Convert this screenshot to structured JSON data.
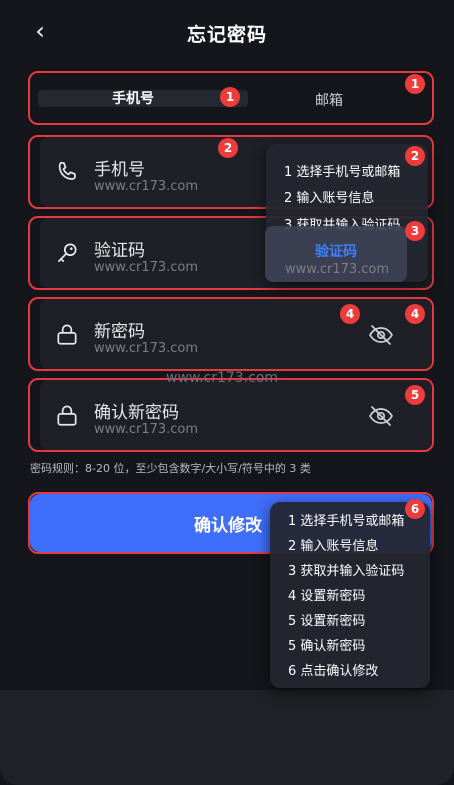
{
  "header": {
    "back_icon": "chevron-left-icon",
    "back_glyph": "‹",
    "title": "忘记密码"
  },
  "segmented": {
    "phone_label": "手机号",
    "email_label": "邮箱",
    "selected": "手机号"
  },
  "fields": {
    "phone": {
      "label": "手机号",
      "icon": "phone-icon",
      "watermark": "www.cr173.com"
    },
    "code": {
      "label": "验证码",
      "icon": "key-icon",
      "watermark": "www.cr173.com",
      "button_label": "验证码",
      "button_watermark": "www.cr173.com"
    },
    "new_password": {
      "label": "新密码",
      "icon": "lock-icon",
      "eye_icon": "eye-off-icon",
      "watermark": "www.cr173.com"
    },
    "confirm_password": {
      "label": "确认新密码",
      "icon": "lock-icon",
      "eye_icon": "eye-off-icon",
      "watermark": "www.cr173.com"
    }
  },
  "center_watermark": "www.cr173.com",
  "password_rules": "密码规则：8-20 位，至少包含数字/大小写/符号中的 3 类",
  "confirm_button": {
    "label": "确认修改"
  },
  "badges": [
    "1",
    "1",
    "2",
    "2",
    "3",
    "4",
    "4",
    "5",
    "6"
  ],
  "tooltip_small": [
    "1 选择手机号或邮箱",
    "2 输入账号信息",
    "3 获取并输入验证码"
  ],
  "tooltip_large": [
    "1 选择手机号或邮箱",
    "2 输入账号信息",
    "3 获取并输入验证码",
    "4 设置新密码",
    "5 设置新密码",
    "5 确认新密码",
    "6 点击确认修改"
  ],
  "colors": {
    "background": "#15161b",
    "accent": "#3f6efb",
    "highlight_red": "#e4393f",
    "code_button_text": "#3d80ff"
  }
}
